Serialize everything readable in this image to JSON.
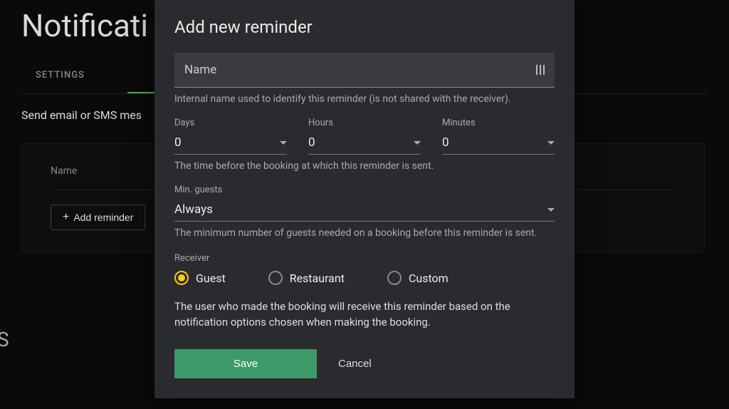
{
  "page": {
    "title": "Notificati",
    "subtitle": "Send email or SMS mes",
    "tabs": {
      "settings": "SETTINGS"
    },
    "table": {
      "header_name": "Name"
    },
    "add_reminder_label": "Add reminder",
    "side_char": "S"
  },
  "modal": {
    "title": "Add new reminder",
    "name_placeholder": "Name",
    "name_helper": "Internal name used to identify this reminder (is not shared with the receiver).",
    "time": {
      "days_label": "Days",
      "days_value": "0",
      "hours_label": "Hours",
      "hours_value": "0",
      "minutes_label": "Minutes",
      "minutes_value": "0",
      "helper": "The time before the booking at which this reminder is sent."
    },
    "min_guests": {
      "label": "Min. guests",
      "value": "Always",
      "helper": "The minimum number of guests needed on a booking before this reminder is sent."
    },
    "receiver": {
      "label": "Receiver",
      "options": {
        "guest": "Guest",
        "restaurant": "Restaurant",
        "custom": "Custom"
      },
      "selected": "guest",
      "description": "The user who made the booking will receive this reminder based on the notification options chosen when making the booking."
    },
    "actions": {
      "save": "Save",
      "cancel": "Cancel"
    }
  }
}
